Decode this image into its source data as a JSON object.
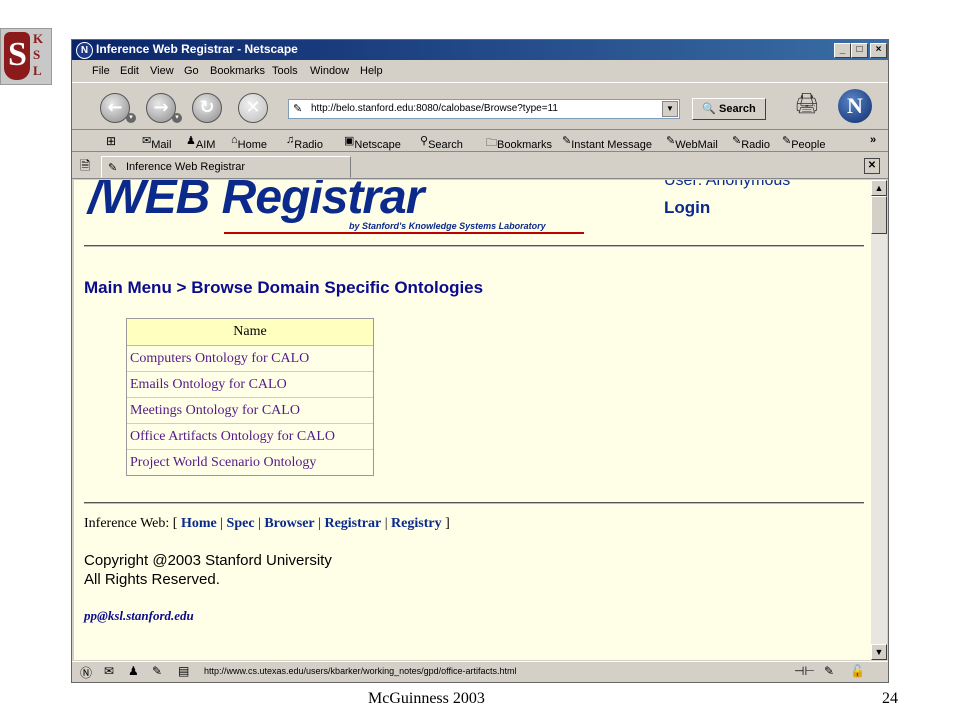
{
  "logo": {
    "s": "S",
    "k": "K",
    "s2": "S",
    "l": "L"
  },
  "window": {
    "title": "Inference Web Registrar - Netscape",
    "controls": {
      "minimize": "_",
      "maximize": "□",
      "close": "×"
    }
  },
  "menu": [
    "File",
    "Edit",
    "View",
    "Go",
    "Bookmarks",
    "Tools",
    "Window",
    "Help"
  ],
  "nav": {
    "url": "http://belo.stanford.edu:8080/calobase/Browse?type=11",
    "search_label": "Search"
  },
  "personal_toolbar": [
    "Mail",
    "AIM",
    "Home",
    "Radio",
    "Netscape",
    "Search",
    "Bookmarks",
    "Instant Message",
    "WebMail",
    "Radio",
    "People"
  ],
  "tab": {
    "label": "Inference Web Registrar"
  },
  "page": {
    "brand_main": "WEB",
    "brand_word": "Registrar",
    "brand_sub": "by Stanford's Knowledge Systems Laboratory",
    "user": "User: Anonymous",
    "login": "Login",
    "breadcrumb": "Main Menu > Browse Domain Specific Ontologies",
    "table": {
      "header": "Name",
      "rows": [
        "Computers Ontology for CALO",
        "Emails Ontology for CALO",
        "Meetings Ontology for CALO",
        "Office Artifacts Ontology for CALO",
        "Project World Scenario Ontology"
      ]
    },
    "footer": {
      "prefix": "Inference Web: [",
      "links": [
        "Home",
        "Spec",
        "Browser",
        "Registrar",
        "Registry"
      ],
      "suffix": "]",
      "copyright1": "Copyright @2003 Stanford University",
      "copyright2": "All Rights Reserved.",
      "email": "pp@ksl.stanford.edu"
    }
  },
  "status": {
    "url": "http://www.cs.utexas.edu/users/kbarker/working_notes/gpd/office-artifacts.html"
  },
  "slide_footer": {
    "author": "McGuinness 2003",
    "page": "24"
  }
}
